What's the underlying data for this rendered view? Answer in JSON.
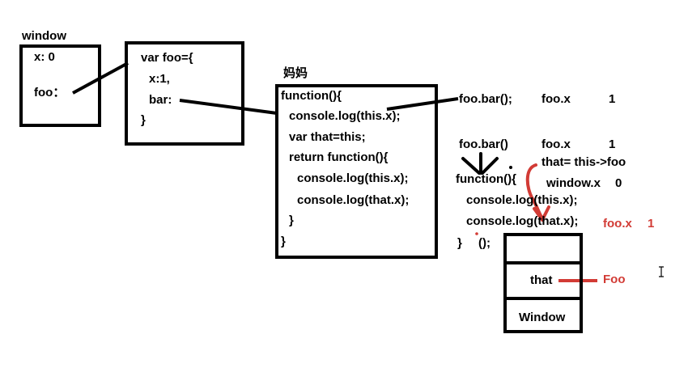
{
  "window_box": {
    "title": "window",
    "x_prop": "x: 0",
    "foo_prop": "foo："
  },
  "foo_object": {
    "line1": "var foo={",
    "line2": "x:1,",
    "line3": "bar:",
    "line4": "}"
  },
  "mother_label": "妈妈",
  "function_box": {
    "lines": [
      "function(){",
      "console.log(this.x);",
      "var that=this;",
      "return function(){",
      "console.log(this.x);",
      "console.log(that.x);",
      "}",
      "}"
    ]
  },
  "call_one": {
    "expr": "foo.bar();",
    "prop": "foo.x",
    "value": "1"
  },
  "call_two": {
    "expr": "foo.bar()",
    "prop": "foo.x",
    "value": "1"
  },
  "that_note": "that=  this->foo",
  "window_note": {
    "prop": "window.x",
    "value": "0"
  },
  "inner_function": {
    "line1": "function(){",
    "line2": "console.log(this.x);",
    "line3": "console.log(that.x);",
    "line4": "}",
    "call": "();"
  },
  "result_note": {
    "prop": "foo.x",
    "value": "1"
  },
  "stack": {
    "that_label": "that",
    "window_label": "Window",
    "foo_label": "Foo"
  },
  "colors": {
    "ink": "#000000",
    "annotation": "#d23b35"
  }
}
